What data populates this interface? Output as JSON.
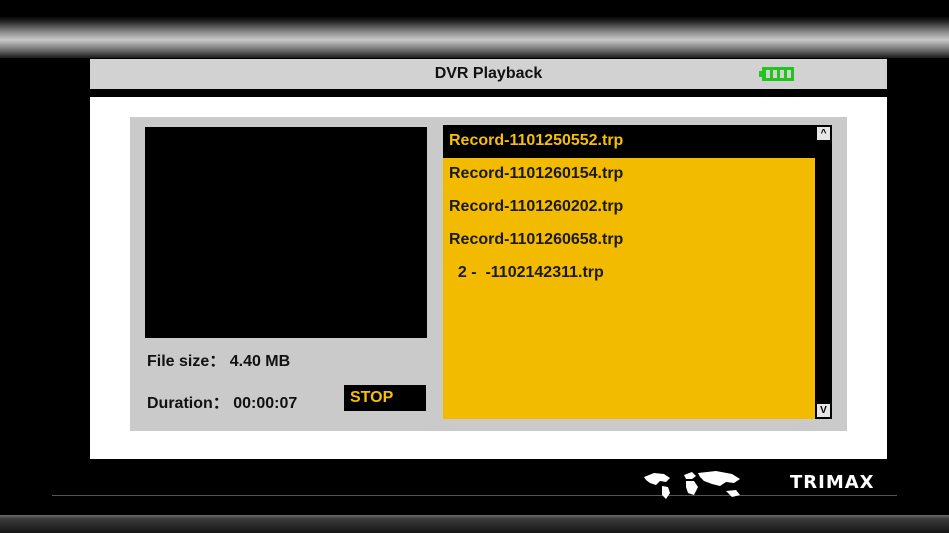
{
  "header": {
    "title": "DVR Playback",
    "battery_icon": "battery-full-icon",
    "battery_color": "#22c41e"
  },
  "preview": {
    "file_size_label": "File size：",
    "file_size_value": "4.40 MB",
    "duration_label": "Duration：",
    "duration_value": "00:00:07",
    "status": "STOP"
  },
  "file_list": {
    "items": [
      "Record-1101250552.trp",
      "Record-1101260154.trp",
      "Record-1101260202.trp",
      "Record-1101260658.trp",
      "  2 -  -1102142311.trp"
    ],
    "selected_index": 0,
    "scroll_up_label": "^",
    "scroll_down_label": "V"
  },
  "footer": {
    "brand": "TRIMAX",
    "map_icon": "world-map-icon"
  },
  "colors": {
    "list_background": "#f3bb00",
    "highlight_text": "#f5c000",
    "title_bar": "#d2d2d2"
  }
}
